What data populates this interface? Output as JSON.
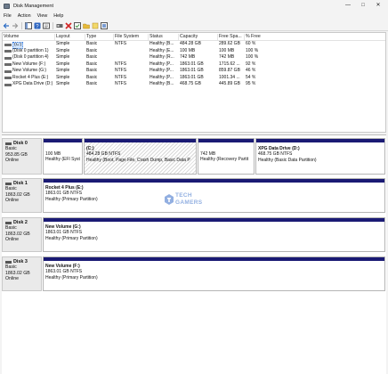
{
  "window": {
    "title": "Disk Management"
  },
  "menu": [
    "File",
    "Action",
    "View",
    "Help"
  ],
  "toolbar": {
    "buttons": [
      "back-icon",
      "forward-icon",
      "console-tree-icon",
      "help-icon",
      "properties-icon",
      "refresh-icon",
      "delete-icon",
      "check-icon",
      "folder-icon",
      "rescan-icon",
      "export-icon"
    ]
  },
  "volume_list": {
    "columns": [
      "Volume",
      "Layout",
      "Type",
      "File System",
      "Status",
      "Capacity",
      "Free Spa...",
      "% Free"
    ],
    "rows": [
      {
        "volume": "(C:)",
        "layout": "Simple",
        "type": "Basic",
        "fs": "NTFS",
        "status": "Healthy (B...",
        "capacity": "484.28 GB",
        "free": "289.62 GB",
        "pct": "60 %"
      },
      {
        "volume": "(Disk 0 partition 1)",
        "layout": "Simple",
        "type": "Basic",
        "fs": "",
        "status": "Healthy (E...",
        "capacity": "100 MB",
        "free": "100 MB",
        "pct": "100 %"
      },
      {
        "volume": "(Disk 0 partition 4)",
        "layout": "Simple",
        "type": "Basic",
        "fs": "",
        "status": "Healthy (R...",
        "capacity": "742 MB",
        "free": "742 MB",
        "pct": "100 %"
      },
      {
        "volume": "New Volume (F:)",
        "layout": "Simple",
        "type": "Basic",
        "fs": "NTFS",
        "status": "Healthy (P...",
        "capacity": "1863.01 GB",
        "free": "1715.62 ...",
        "pct": "92 %"
      },
      {
        "volume": "New Volume (G:)",
        "layout": "Simple",
        "type": "Basic",
        "fs": "NTFS",
        "status": "Healthy (P...",
        "capacity": "1863.01 GB",
        "free": "859.87 GB",
        "pct": "46 %"
      },
      {
        "volume": "Rocket 4 Plus (E:)",
        "layout": "Simple",
        "type": "Basic",
        "fs": "NTFS",
        "status": "Healthy (P...",
        "capacity": "1863.01 GB",
        "free": "1001.34 ...",
        "pct": "54 %"
      },
      {
        "volume": "XPG Data Drive (D:)",
        "layout": "Simple",
        "type": "Basic",
        "fs": "NTFS",
        "status": "Healthy (B...",
        "capacity": "468.75 GB",
        "free": "445.89 GB",
        "pct": "95 %"
      }
    ]
  },
  "disks": [
    {
      "name": "Disk 0",
      "type": "Basic",
      "size": "953.85 GB",
      "state": "Online",
      "partitions": [
        {
          "name": "",
          "size": "100 MB",
          "status": "Healthy (EFI Syst"
        },
        {
          "name": "(C:)",
          "size": "484.28 GB NTFS",
          "status": "Healthy (Boot, Page File, Crash Dump, Basic Data P"
        },
        {
          "name": "",
          "size": "742 MB",
          "status": "Healthy (Recovery Partit"
        },
        {
          "name": "XPG Data Drive  (D:)",
          "size": "468.75 GB NTFS",
          "status": "Healthy (Basic Data Partition)"
        }
      ]
    },
    {
      "name": "Disk 1",
      "type": "Basic",
      "size": "1863.02 GB",
      "state": "Online",
      "partitions": [
        {
          "name": "Rocket 4 Plus  (E:)",
          "size": "1863.01 GB NTFS",
          "status": "Healthy (Primary Partition)"
        }
      ]
    },
    {
      "name": "Disk 2",
      "type": "Basic",
      "size": "1863.02 GB",
      "state": "Online",
      "partitions": [
        {
          "name": "New Volume  (G:)",
          "size": "1863.01 GB NTFS",
          "status": "Healthy (Primary Partition)"
        }
      ]
    },
    {
      "name": "Disk 3",
      "type": "Basic",
      "size": "1863.02 GB",
      "state": "Online",
      "partitions": [
        {
          "name": "New Volume  (F:)",
          "size": "1863.01 GB NTFS",
          "status": "Healthy (Primary Partition)"
        }
      ]
    }
  ],
  "watermark": {
    "line1": "TECH",
    "line2": "GAMERS"
  },
  "colors": {
    "partition_bar": "#1a1a74",
    "selection": "#cfe4ff",
    "watermark": "#3a6fc9"
  }
}
